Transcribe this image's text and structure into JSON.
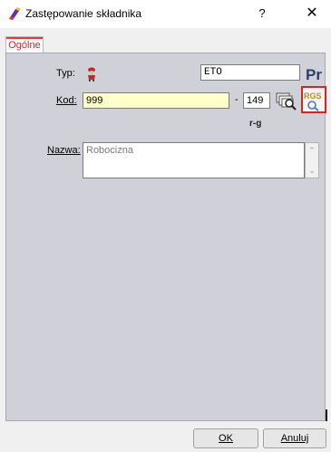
{
  "window": {
    "title": "Zastępowanie składnika",
    "help_label": "?",
    "close_label": "✕"
  },
  "tabs": [
    {
      "label": "Ogólne"
    }
  ],
  "form": {
    "typ_label": "Typ:",
    "typ_value": "ETO",
    "pr_label": "Pr",
    "kod_label": "Kod:",
    "kod_value": "999",
    "kod_separator": "-",
    "kod_suffix": "149",
    "rg_label": "r-g",
    "rgs_label": "RGS",
    "nazwa_label": "Nazwa:",
    "nazwa_value": "Robocizna"
  },
  "buttons": {
    "ok_label": "OK",
    "cancel_label": "Anuluj"
  },
  "colors": {
    "tab_accent": "#e53935",
    "kod_field_bg": "#ffffcc",
    "rgs_highlight": "#e02020",
    "panel_bg": "#cfd0d8"
  }
}
